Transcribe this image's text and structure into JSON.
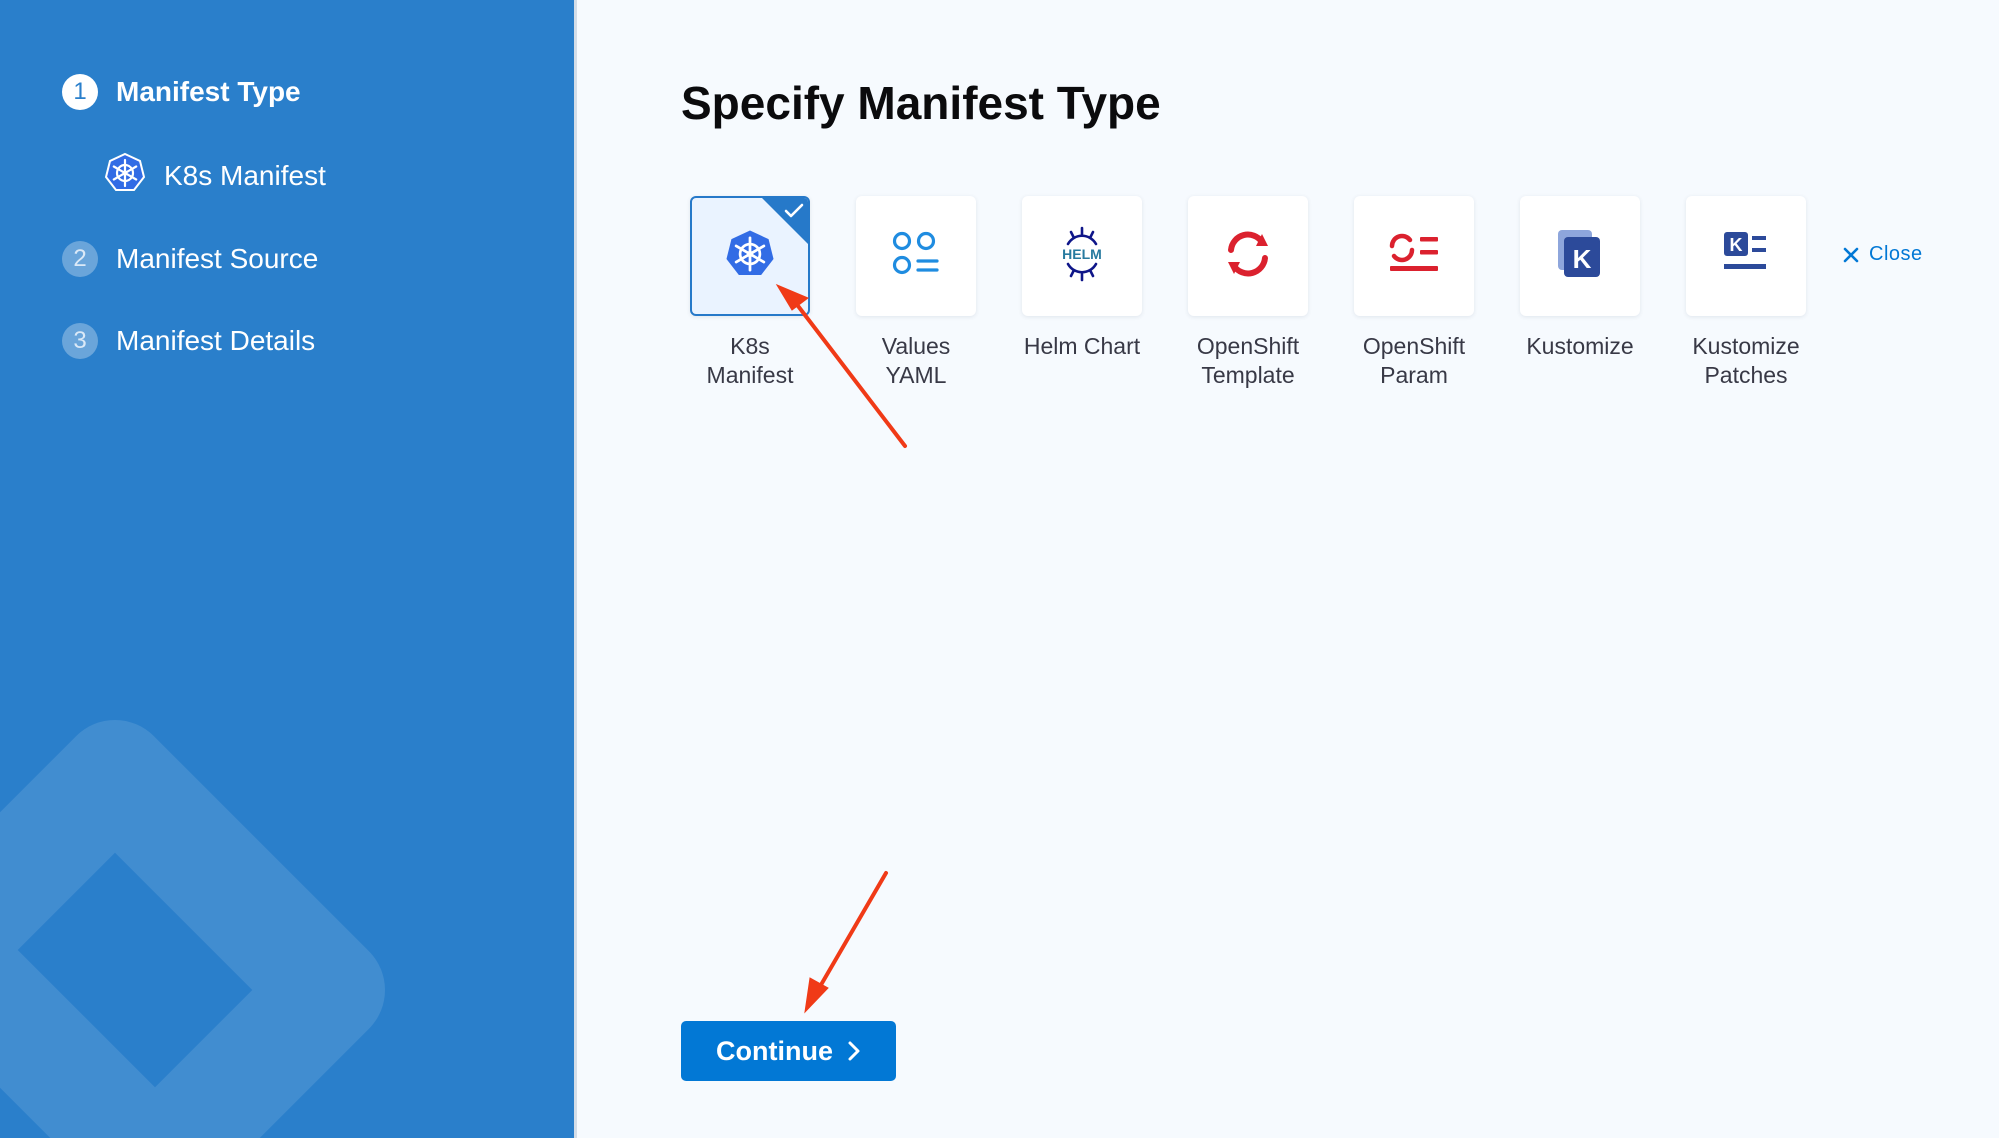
{
  "sidebar": {
    "steps": [
      {
        "number": "1",
        "label": "Manifest Type"
      },
      {
        "number": "2",
        "label": "Manifest Source"
      },
      {
        "number": "3",
        "label": "Manifest Details"
      }
    ],
    "substep": {
      "label": "K8s Manifest",
      "icon": "kubernetes-icon"
    },
    "colors": {
      "background": "#2a7fcb"
    }
  },
  "main": {
    "title": "Specify Manifest Type",
    "close_label": "Close",
    "continue_label": "Continue",
    "selected_type": "K8s Manifest",
    "manifest_types": [
      {
        "label": "K8s\nManifest",
        "icon": "kubernetes-icon",
        "selected": true
      },
      {
        "label": "Values\nYAML",
        "icon": "values-yaml-icon",
        "selected": false
      },
      {
        "label": "Helm Chart",
        "icon": "helm-icon",
        "selected": false
      },
      {
        "label": "OpenShift\nTemplate",
        "icon": "openshift-icon",
        "selected": false
      },
      {
        "label": "OpenShift\nParam",
        "icon": "openshift-param-icon",
        "selected": false
      },
      {
        "label": "Kustomize",
        "icon": "kustomize-icon",
        "selected": false
      },
      {
        "label": "Kustomize\nPatches",
        "icon": "kustomize-patches-icon",
        "selected": false
      }
    ],
    "colors": {
      "accent": "#0278d5",
      "selected_border": "#2679c9",
      "annotation": "#f03a17"
    }
  }
}
